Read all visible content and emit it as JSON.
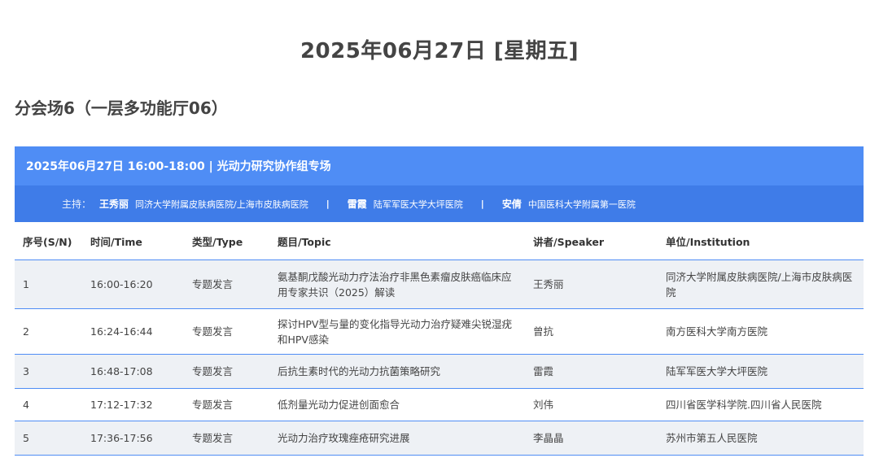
{
  "date_title": "2025年06月27日 [星期五]",
  "venue_title": "分会场6（一层多功能厅06）",
  "session": {
    "header": "2025年06月27日 16:00-18:00 | 光动力研究协作组专场",
    "host_prefix": "主持：",
    "hosts": [
      {
        "name": "王秀丽",
        "institution": "同济大学附属皮肤病医院/上海市皮肤病医院"
      },
      {
        "name": "雷霞",
        "institution": "陆军军医大学大坪医院"
      },
      {
        "name": "安倩",
        "institution": "中国医科大学附属第一医院"
      }
    ],
    "separator": "|"
  },
  "table": {
    "headers": [
      "序号(S/N)",
      "时间/Time",
      "类型/Type",
      "题目/Topic",
      "讲者/Speaker",
      "单位/Institution"
    ],
    "rows": [
      {
        "sn": "1",
        "time": "16:00-16:20",
        "type": "专题发言",
        "topic": "氨基酮戊酸光动力疗法治疗非黑色素瘤皮肤癌临床应用专家共识（2025）解读",
        "speaker": "王秀丽",
        "institution": "同济大学附属皮肤病医院/上海市皮肤病医院"
      },
      {
        "sn": "2",
        "time": "16:24-16:44",
        "type": "专题发言",
        "topic": "探讨HPV型与量的变化指导光动力治疗疑难尖锐湿疣和HPV感染",
        "speaker": "曾抗",
        "institution": "南方医科大学南方医院"
      },
      {
        "sn": "3",
        "time": "16:48-17:08",
        "type": "专题发言",
        "topic": "后抗生素时代的光动力抗菌策略研究",
        "speaker": "雷霞",
        "institution": "陆军军医大学大坪医院"
      },
      {
        "sn": "4",
        "time": "17:12-17:32",
        "type": "专题发言",
        "topic": "低剂量光动力促进创面愈合",
        "speaker": "刘伟",
        "institution": "四川省医学科学院.四川省人民医院"
      },
      {
        "sn": "5",
        "time": "17:36-17:56",
        "type": "专题发言",
        "topic": "光动力治疗玫瑰痤疮研究进展",
        "speaker": "李晶晶",
        "institution": "苏州市第五人民医院"
      }
    ]
  },
  "colors": {
    "header_blue": "#4f8df5",
    "hosts_blue": "#3f7ce8",
    "row_shade": "#eef1f5",
    "divider": "#4f8df5"
  }
}
